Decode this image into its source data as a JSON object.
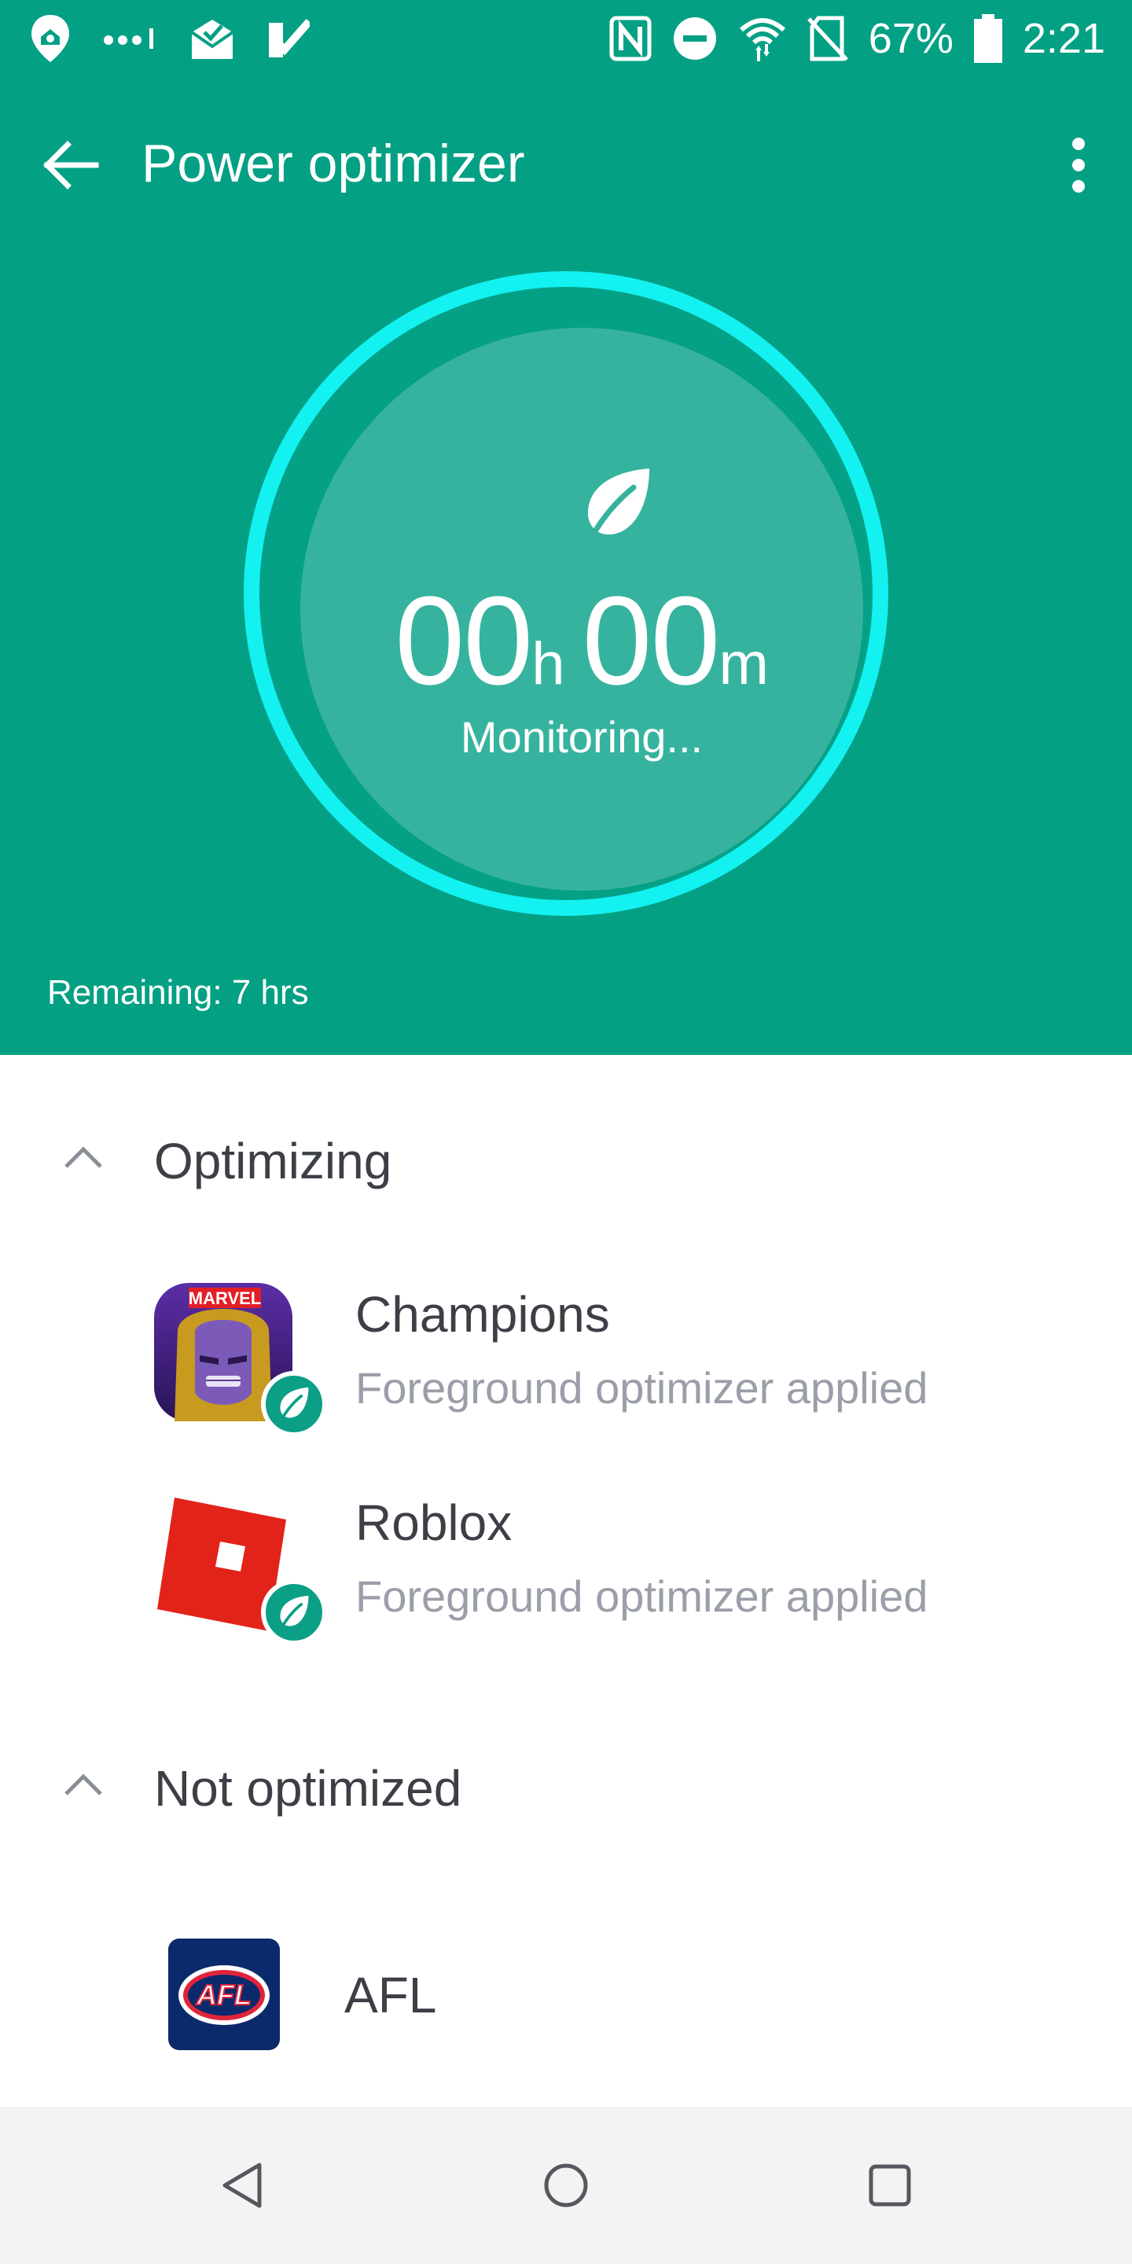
{
  "status_bar": {
    "battery_percent": "67%",
    "time": "2:21"
  },
  "app_bar": {
    "title": "Power optimizer"
  },
  "monitor": {
    "hours": "00",
    "hours_unit": "h",
    "minutes": "00",
    "minutes_unit": "m",
    "status": "Monitoring...",
    "remaining": "Remaining: 7 hrs"
  },
  "sections": {
    "optimizing": {
      "label": "Optimizing",
      "apps": [
        {
          "name": "Champions",
          "status": "Foreground optimizer applied"
        },
        {
          "name": "Roblox",
          "status": "Foreground optimizer applied"
        }
      ]
    },
    "not_optimized": {
      "label": "Not optimized",
      "apps": [
        {
          "name": "AFL",
          "logo_text": "AFL"
        }
      ]
    }
  },
  "colors": {
    "primary": "#04a084",
    "ring": "#14f1f1",
    "inner_circle": "#36b39e",
    "badge": "#0b9f86"
  },
  "icons": {
    "back": "arrow-left-icon",
    "more": "more-vert-icon",
    "leaf": "leaf-icon",
    "collapse": "chevron-up-icon"
  }
}
